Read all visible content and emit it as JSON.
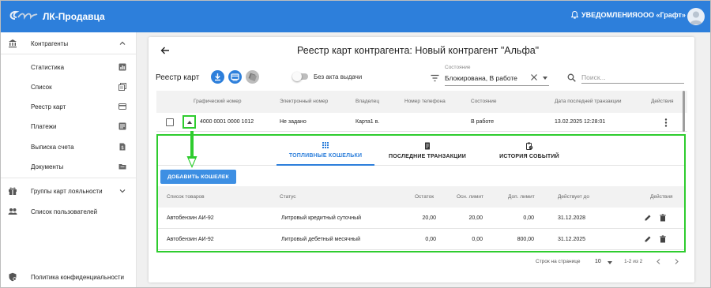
{
  "app": {
    "title": "ЛК-Продавца"
  },
  "header": {
    "notifications_label": "УВЕДОМЛЕНИЯ",
    "org_name": "ООО «Графт»"
  },
  "sidebar": {
    "items": [
      {
        "label": "Контрагенты",
        "icon": "bank-icon"
      },
      {
        "label": "Статистика",
        "icon": "chart-icon"
      },
      {
        "label": "Список",
        "icon": "list-stack-icon"
      },
      {
        "label": "Реестр карт",
        "icon": "credit-card-icon"
      },
      {
        "label": "Платежи",
        "icon": "document-lines-icon"
      },
      {
        "label": "Выписка счета",
        "icon": "dollar-doc-icon"
      },
      {
        "label": "Документы",
        "icon": "folder-icon"
      },
      {
        "label": "Группы карт лояльности",
        "icon": "gift-icon"
      },
      {
        "label": "Список пользователей",
        "icon": "people-icon"
      },
      {
        "label": "Политика конфиденциальности",
        "icon": "shield-icon"
      }
    ]
  },
  "page": {
    "title": "Реестр карт контрагента: Новый контрагент \"Альфа\""
  },
  "toolbar": {
    "label": "Реестр карт",
    "toggle_label": "Без акта выдачи",
    "state_caption": "Состояние",
    "state_value": "Блокирована, В работе",
    "search_placeholder": "Поиск..."
  },
  "cards_table": {
    "headers": [
      "Графический номер",
      "Электронный номер",
      "Владелец",
      "Номер телефона",
      "Состояние",
      "Дата последней транзакции",
      "Действия"
    ],
    "rows": [
      {
        "graphic_number": "4000 0001 0000 1012",
        "electronic_number": "Не задано",
        "owner": "Карта1 в.",
        "phone": "",
        "state": "В работе",
        "last_tx": "13.02.2025 12:28:01"
      }
    ]
  },
  "panel": {
    "tabs": [
      {
        "label": "ТОПЛИВНЫЕ КОШЕЛЬКИ",
        "icon": "grid-icon",
        "active": true
      },
      {
        "label": "ПОСЛЕДНИЕ ТРАНЗАКЦИИ",
        "icon": "receipt-icon",
        "active": false
      },
      {
        "label": "ИСТОРИЯ СОБЫТИЙ",
        "icon": "clipboard-clock-icon",
        "active": false
      }
    ],
    "add_button": "ДОБАВИТЬ КОШЕЛЕК",
    "headers": [
      "Список товаров",
      "Статус",
      "Остаток",
      "Осн. лимит",
      "Доп. лимит",
      "Действует до",
      "Действия"
    ],
    "rows": [
      {
        "product": "Автобензин АИ-92",
        "status": "Литровый кредитный суточный",
        "balance": "20,00",
        "main_limit": "20,00",
        "extra_limit": "0,00",
        "valid_until": "31.12.2028"
      },
      {
        "product": "Автобензин АИ-92",
        "status": "Литровый дебетный месячный",
        "balance": "0,00",
        "main_limit": "0,00",
        "extra_limit": "800,00",
        "valid_until": "31.12.2025"
      }
    ]
  },
  "pagination": {
    "label": "Строк на странице",
    "page_size": "10",
    "range": "1-2 из 2"
  },
  "colors": {
    "primary": "#2d7fdb",
    "highlight": "#2ecc2e",
    "button": "#3d8fe3"
  }
}
